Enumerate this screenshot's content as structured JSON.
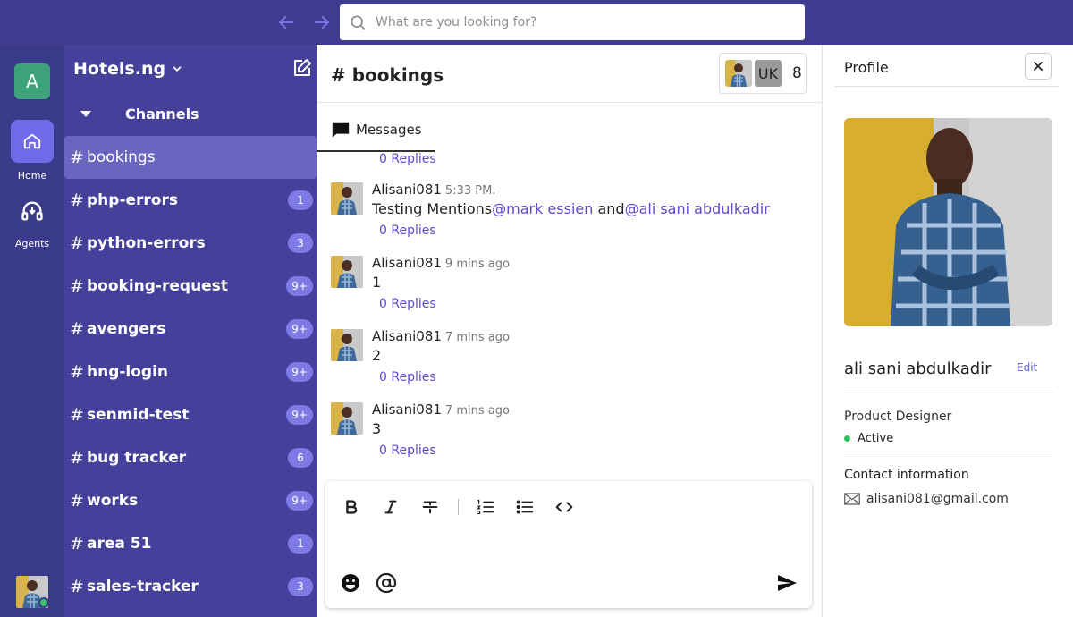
{
  "topbar": {
    "back_icon": "arrow-left-icon",
    "forward_icon": "arrow-right-icon",
    "search_placeholder": "What are you looking for?"
  },
  "rail": {
    "workspace_initial": "A",
    "home_label": "Home",
    "agents_label": "Agents"
  },
  "sidebar": {
    "workspace_name": "Hotels.ng",
    "channels_label": "Channels",
    "channels": [
      {
        "name": "bookings",
        "badge": "",
        "active": true
      },
      {
        "name": "php-errors",
        "badge": "1"
      },
      {
        "name": "python-errors",
        "badge": "3"
      },
      {
        "name": "booking-request",
        "badge": "9+"
      },
      {
        "name": "avengers",
        "badge": "9+"
      },
      {
        "name": "hng-login",
        "badge": "9+"
      },
      {
        "name": "senmid-test",
        "badge": "9+"
      },
      {
        "name": "bug tracker",
        "badge": "6"
      },
      {
        "name": "works",
        "badge": "9+"
      },
      {
        "name": "area 51",
        "badge": "1"
      },
      {
        "name": "sales-tracker",
        "badge": "3"
      }
    ]
  },
  "main": {
    "channel_title": "# bookings",
    "member_initials": "UK",
    "member_count": "8",
    "tab_label": "Messages",
    "first_replies": "0 Replies",
    "messages": [
      {
        "user": "Alisani081",
        "time": "5:33 PM.",
        "text_prefix": "Testing Mentions",
        "mention1": "@mark essien",
        "text_mid": " and",
        "mention2": "@ali sani abdulkadir",
        "replies": "0 Replies"
      },
      {
        "user": "Alisani081",
        "time": "9 mins ago",
        "text": "1",
        "replies": "0 Replies"
      },
      {
        "user": "Alisani081",
        "time": "7 mins ago",
        "text": "2",
        "replies": "0 Replies"
      },
      {
        "user": "Alisani081",
        "time": "7 mins ago",
        "text": "3",
        "replies": "0 Replies"
      }
    ]
  },
  "profile": {
    "title": "Profile",
    "name": "ali sani abdulkadir",
    "edit_label": "Edit",
    "role": "Product Designer",
    "status": "Active",
    "contact_heading": "Contact information",
    "email": "alisani081@gmail.com"
  },
  "colors": {
    "topbar": "#3f3b8f",
    "rail": "#3a3a8a",
    "sidebar": "#45419a",
    "active_channel": "#6a66c0",
    "badge": "#7f7be6",
    "accent": "#5a4bd1",
    "online": "#3cc46b"
  }
}
